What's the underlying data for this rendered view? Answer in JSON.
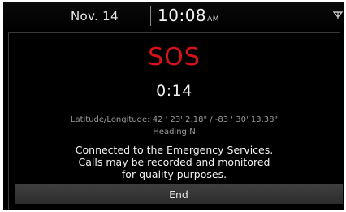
{
  "status_bar": {
    "date": "Nov. 14",
    "time": "10:08",
    "ampm": "AM",
    "signal_icon": "signal-icon"
  },
  "dialog": {
    "title": "SOS",
    "title_color": "#d9121a",
    "timer": "0:14",
    "coordinates": "Latitude/Longitude: 42 ' 23' 2.18\" / -83 ' 30' 13.38\"",
    "heading": "Heading:N",
    "message_lines": [
      "Connected to the Emergency Services.",
      "Calls may be recorded and monitored",
      "for quality purposes."
    ],
    "end_label": "End"
  }
}
